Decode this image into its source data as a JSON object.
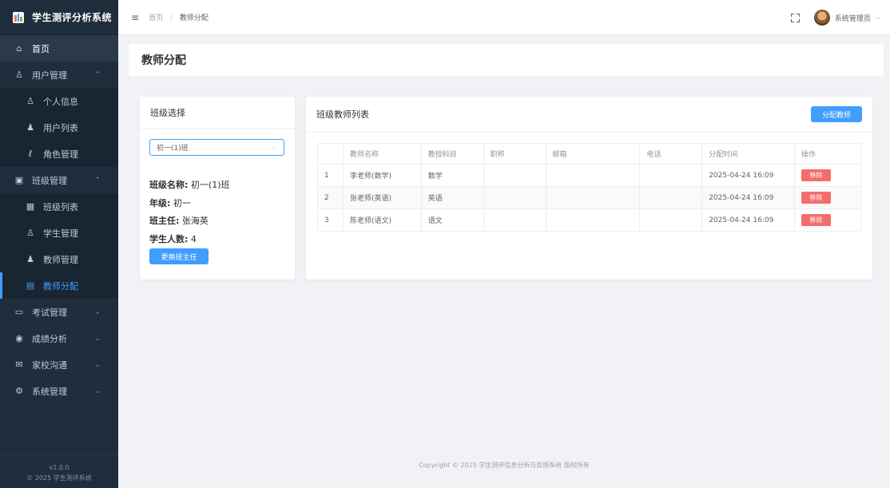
{
  "app": {
    "title": "学生测评分析系统",
    "brand_colors": [
      "#f56c6c",
      "#409eff",
      "#67c23a"
    ]
  },
  "sidebar": {
    "items": [
      {
        "label": "首页",
        "icon": "home-icon",
        "level": 0,
        "state": "home"
      },
      {
        "label": "用户管理",
        "icon": "user-icon",
        "level": 0,
        "arrow": "up"
      },
      {
        "label": "个人信息",
        "icon": "person-icon",
        "level": 1
      },
      {
        "label": "用户列表",
        "icon": "user-solid-icon",
        "level": 1
      },
      {
        "label": "角色管理",
        "icon": "role-icon",
        "level": 1
      },
      {
        "label": "班级管理",
        "icon": "class-icon",
        "level": 0,
        "arrow": "up"
      },
      {
        "label": "班级列表",
        "icon": "grid-icon",
        "level": 1
      },
      {
        "label": "学生管理",
        "icon": "person-icon",
        "level": 1
      },
      {
        "label": "教师管理",
        "icon": "user-solid-icon",
        "level": 1
      },
      {
        "label": "教师分配",
        "icon": "assign-icon",
        "level": 1,
        "state": "active"
      },
      {
        "label": "考试管理",
        "icon": "calendar-icon",
        "level": 0,
        "arrow": "down"
      },
      {
        "label": "成绩分析",
        "icon": "eye-icon",
        "level": 0,
        "arrow": "down"
      },
      {
        "label": "家校沟通",
        "icon": "chat-icon",
        "level": 0,
        "arrow": "down"
      },
      {
        "label": "系统管理",
        "icon": "gear-icon",
        "level": 0,
        "arrow": "down"
      }
    ],
    "version": "v1.0.0",
    "copyright": "© 2025 学生测评系统"
  },
  "header": {
    "breadcrumb": [
      "首页",
      "教师分配"
    ],
    "username": "系统管理员"
  },
  "page": {
    "title": "教师分配"
  },
  "class_panel": {
    "title": "班级选择",
    "selected_class": "初一(1)班",
    "class_name_label": "班级名称:",
    "class_name": "初一(1)班",
    "grade_label": "年级:",
    "grade": "初一",
    "head_teacher_label": "班主任:",
    "head_teacher": "张海英",
    "student_count_label": "学生人数:",
    "student_count": "4",
    "change_button": "更换班主任"
  },
  "teacher_panel": {
    "title": "班级教师列表",
    "assign_button": "分配教师",
    "columns": [
      "",
      "教师名称",
      "教授科目",
      "职称",
      "邮箱",
      "电话",
      "分配时间",
      "操作"
    ],
    "rows": [
      {
        "index": "1",
        "name": "李老师(数学)",
        "subject": "数学",
        "title": "",
        "email": "",
        "phone": "",
        "time": "2025-04-24 16:09",
        "action": "移除"
      },
      {
        "index": "2",
        "name": "张老师(英语)",
        "subject": "英语",
        "title": "",
        "email": "",
        "phone": "",
        "time": "2025-04-24 16:09",
        "action": "移除"
      },
      {
        "index": "3",
        "name": "陈老师(语文)",
        "subject": "语文",
        "title": "",
        "email": "",
        "phone": "",
        "time": "2025-04-24 16:09",
        "action": "移除"
      }
    ]
  },
  "footer": {
    "text": "Copyright © 2025 学生测评信息分析与反馈系统 版权所有"
  }
}
